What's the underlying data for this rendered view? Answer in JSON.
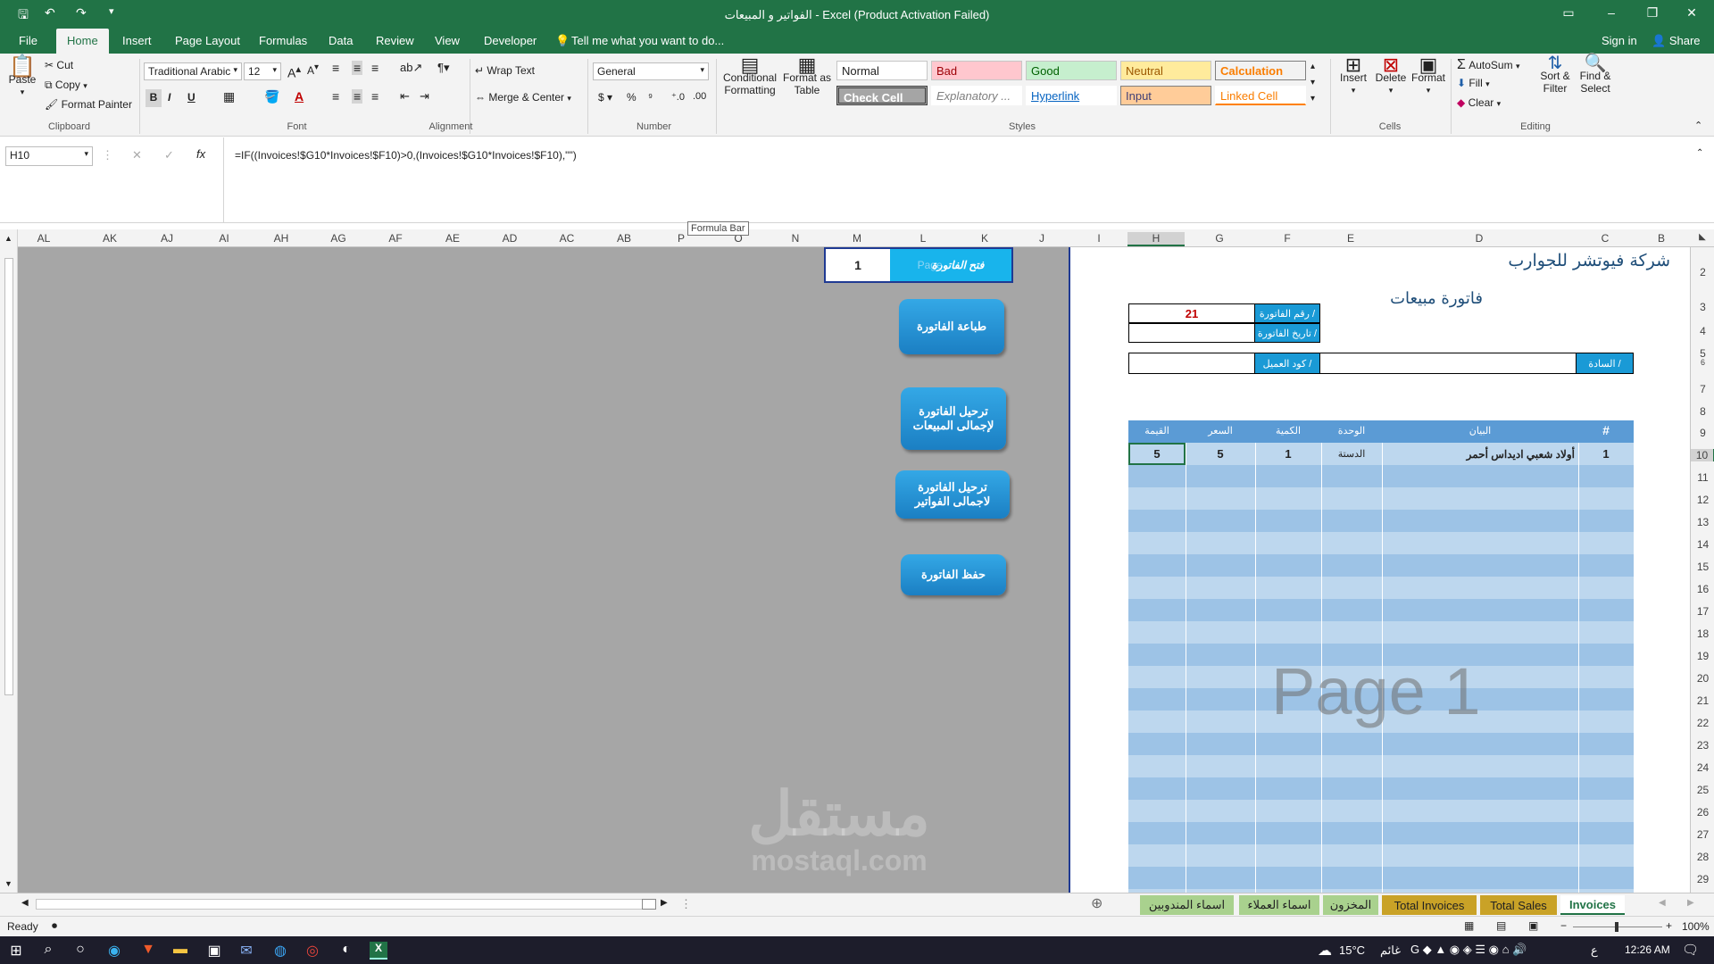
{
  "window": {
    "title": "الفواتير و المبيعات - Excel (Product Activation Failed)",
    "sign_in": "Sign in",
    "share": "Share"
  },
  "ribbon_tabs": [
    "File",
    "Home",
    "Insert",
    "Page Layout",
    "Formulas",
    "Data",
    "Review",
    "View",
    "Developer"
  ],
  "tell_me": "Tell me what you want to do...",
  "ribbon": {
    "clipboard": {
      "paste": "Paste",
      "cut": "Cut",
      "copy": "Copy",
      "format_painter": "Format Painter",
      "label": "Clipboard"
    },
    "font": {
      "name": "Traditional Arabic",
      "size": "12",
      "bold": "B",
      "italic": "I",
      "underline": "U",
      "label": "Font"
    },
    "alignment": {
      "wrap_text": "Wrap Text",
      "merge_center": "Merge & Center",
      "label": "Alignment"
    },
    "number": {
      "format": "General",
      "label": "Number"
    },
    "styles": {
      "conditional_formatting": "Conditional Formatting",
      "format_as_table": "Format as Table",
      "cells": [
        "Normal",
        "Bad",
        "Good",
        "Neutral",
        "Calculation",
        "Check Cell",
        "Explanatory ...",
        "Hyperlink",
        "Input",
        "Linked Cell"
      ],
      "label": "Styles"
    },
    "cells": {
      "insert": "Insert",
      "delete": "Delete",
      "format": "Format",
      "label": "Cells"
    },
    "editing": {
      "autosum": "AutoSum",
      "fill": "Fill",
      "clear": "Clear",
      "sort_filter": "Sort & Filter",
      "find_select": "Find & Select",
      "label": "Editing"
    }
  },
  "formula_bar": {
    "name_box": "H10",
    "formula": "=IF((Invoices!$G10*Invoices!$F10)>0,(Invoices!$G10*Invoices!$F10),\"\")",
    "tooltip": "Formula Bar"
  },
  "columns": [
    "AL",
    "AK",
    "AJ",
    "AI",
    "AH",
    "AG",
    "AF",
    "AE",
    "AD",
    "AC",
    "AB",
    "P",
    "O",
    "N",
    "M",
    "L",
    "K",
    "J",
    "I",
    "H",
    "G",
    "F",
    "E",
    "D",
    "C",
    "B"
  ],
  "rows": [
    "2",
    "3",
    "4",
    "5",
    "6",
    "7",
    "8",
    "9",
    "10",
    "11",
    "12",
    "13",
    "14",
    "15",
    "16",
    "17",
    "18",
    "19",
    "20",
    "21",
    "22",
    "23",
    "24",
    "25",
    "26",
    "27",
    "28",
    "29"
  ],
  "controls": {
    "open_invoice_label": "فتح الفاتورة",
    "open_invoice_value": "1",
    "page_hint": "Page",
    "print_invoice": "طباعة الفاتورة",
    "post_sales": "ترحيل الفاتورة لإجمالى المبيعات",
    "post_invoices": "ترحيل الفاتورة لاجمالى الفواتير",
    "save_invoice": "حفظ الفاتورة"
  },
  "invoice": {
    "company": "شركة فيوتشر للجوارب",
    "title": "فاتورة مبيعات",
    "invoice_no_label": "رقم الفاتورة /",
    "invoice_no": "21",
    "invoice_date_label": "تاريخ الفاتورة /",
    "invoice_date": "",
    "customer_code_label": "كود العميل /",
    "customer_code": "",
    "messrs_label": "السادة /",
    "messrs": "",
    "headers": [
      "القيمة",
      "السعر",
      "الكمية",
      "الوحدة",
      "البيان",
      "#"
    ],
    "items": [
      {
        "value": "5",
        "price": "5",
        "qty": "1",
        "unit": "الدستة",
        "desc": "أولاد شعبي اديداس أحمر",
        "no": "1"
      }
    ],
    "watermark": "Page 1"
  },
  "sheet_tabs": [
    {
      "label": "اسماء المندوبين",
      "color": "#a9d18e"
    },
    {
      "label": "اسماء العملاء",
      "color": "#a9d18e"
    },
    {
      "label": "المخزون",
      "color": "#a9d18e"
    },
    {
      "label": "Total Invoices",
      "color": "#c9a227"
    },
    {
      "label": "Total Sales",
      "color": "#c9a227"
    },
    {
      "label": "Invoices",
      "color": "#ffffff"
    }
  ],
  "status": {
    "ready": "Ready",
    "zoom": "100%"
  },
  "taskbar": {
    "weather": "15°C",
    "weather_text": "غائم",
    "lang": "ع",
    "time": "12:26 AM"
  },
  "brand_watermark": {
    "line1": "مستقل",
    "line2": "mostaql.com"
  }
}
